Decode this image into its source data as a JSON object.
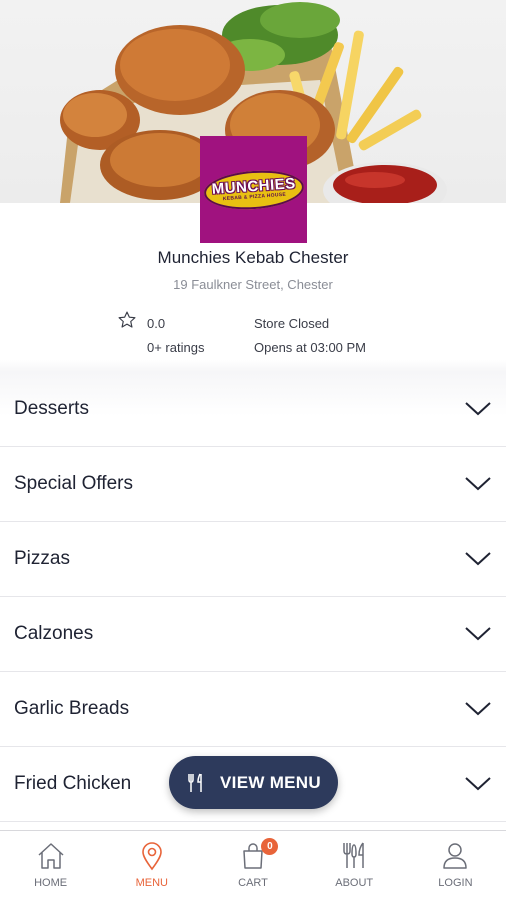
{
  "store": {
    "logo_text": "MUNCHIES",
    "logo_subtext": "KEBAB & PIZZA HOUSE",
    "name": "Munchies Kebab Chester",
    "address": "19 Faulkner Street, Chester",
    "rating": "0.0",
    "ratings_count": "0+ ratings",
    "status": "Store Closed",
    "opens_at": "Opens at 03:00 PM"
  },
  "categories": [
    {
      "label": "Desserts"
    },
    {
      "label": "Special Offers"
    },
    {
      "label": "Pizzas"
    },
    {
      "label": "Calzones"
    },
    {
      "label": "Garlic Breads"
    },
    {
      "label": "Fried Chicken"
    }
  ],
  "view_menu_button": {
    "label": "VIEW MENU"
  },
  "bottom_nav": {
    "items": [
      {
        "label": "HOME",
        "icon": "home-icon"
      },
      {
        "label": "MENU",
        "icon": "location-pin-icon",
        "active": true
      },
      {
        "label": "CART",
        "icon": "cart-bag-icon",
        "badge": "0"
      },
      {
        "label": "ABOUT",
        "icon": "cutlery-icon"
      },
      {
        "label": "LOGIN",
        "icon": "user-icon"
      }
    ]
  },
  "colors": {
    "accent": "#e8643a",
    "button_bg": "#2d3a5c",
    "logo_bg": "#a0127f",
    "text": "#1f2333",
    "muted": "#8a8d96"
  }
}
